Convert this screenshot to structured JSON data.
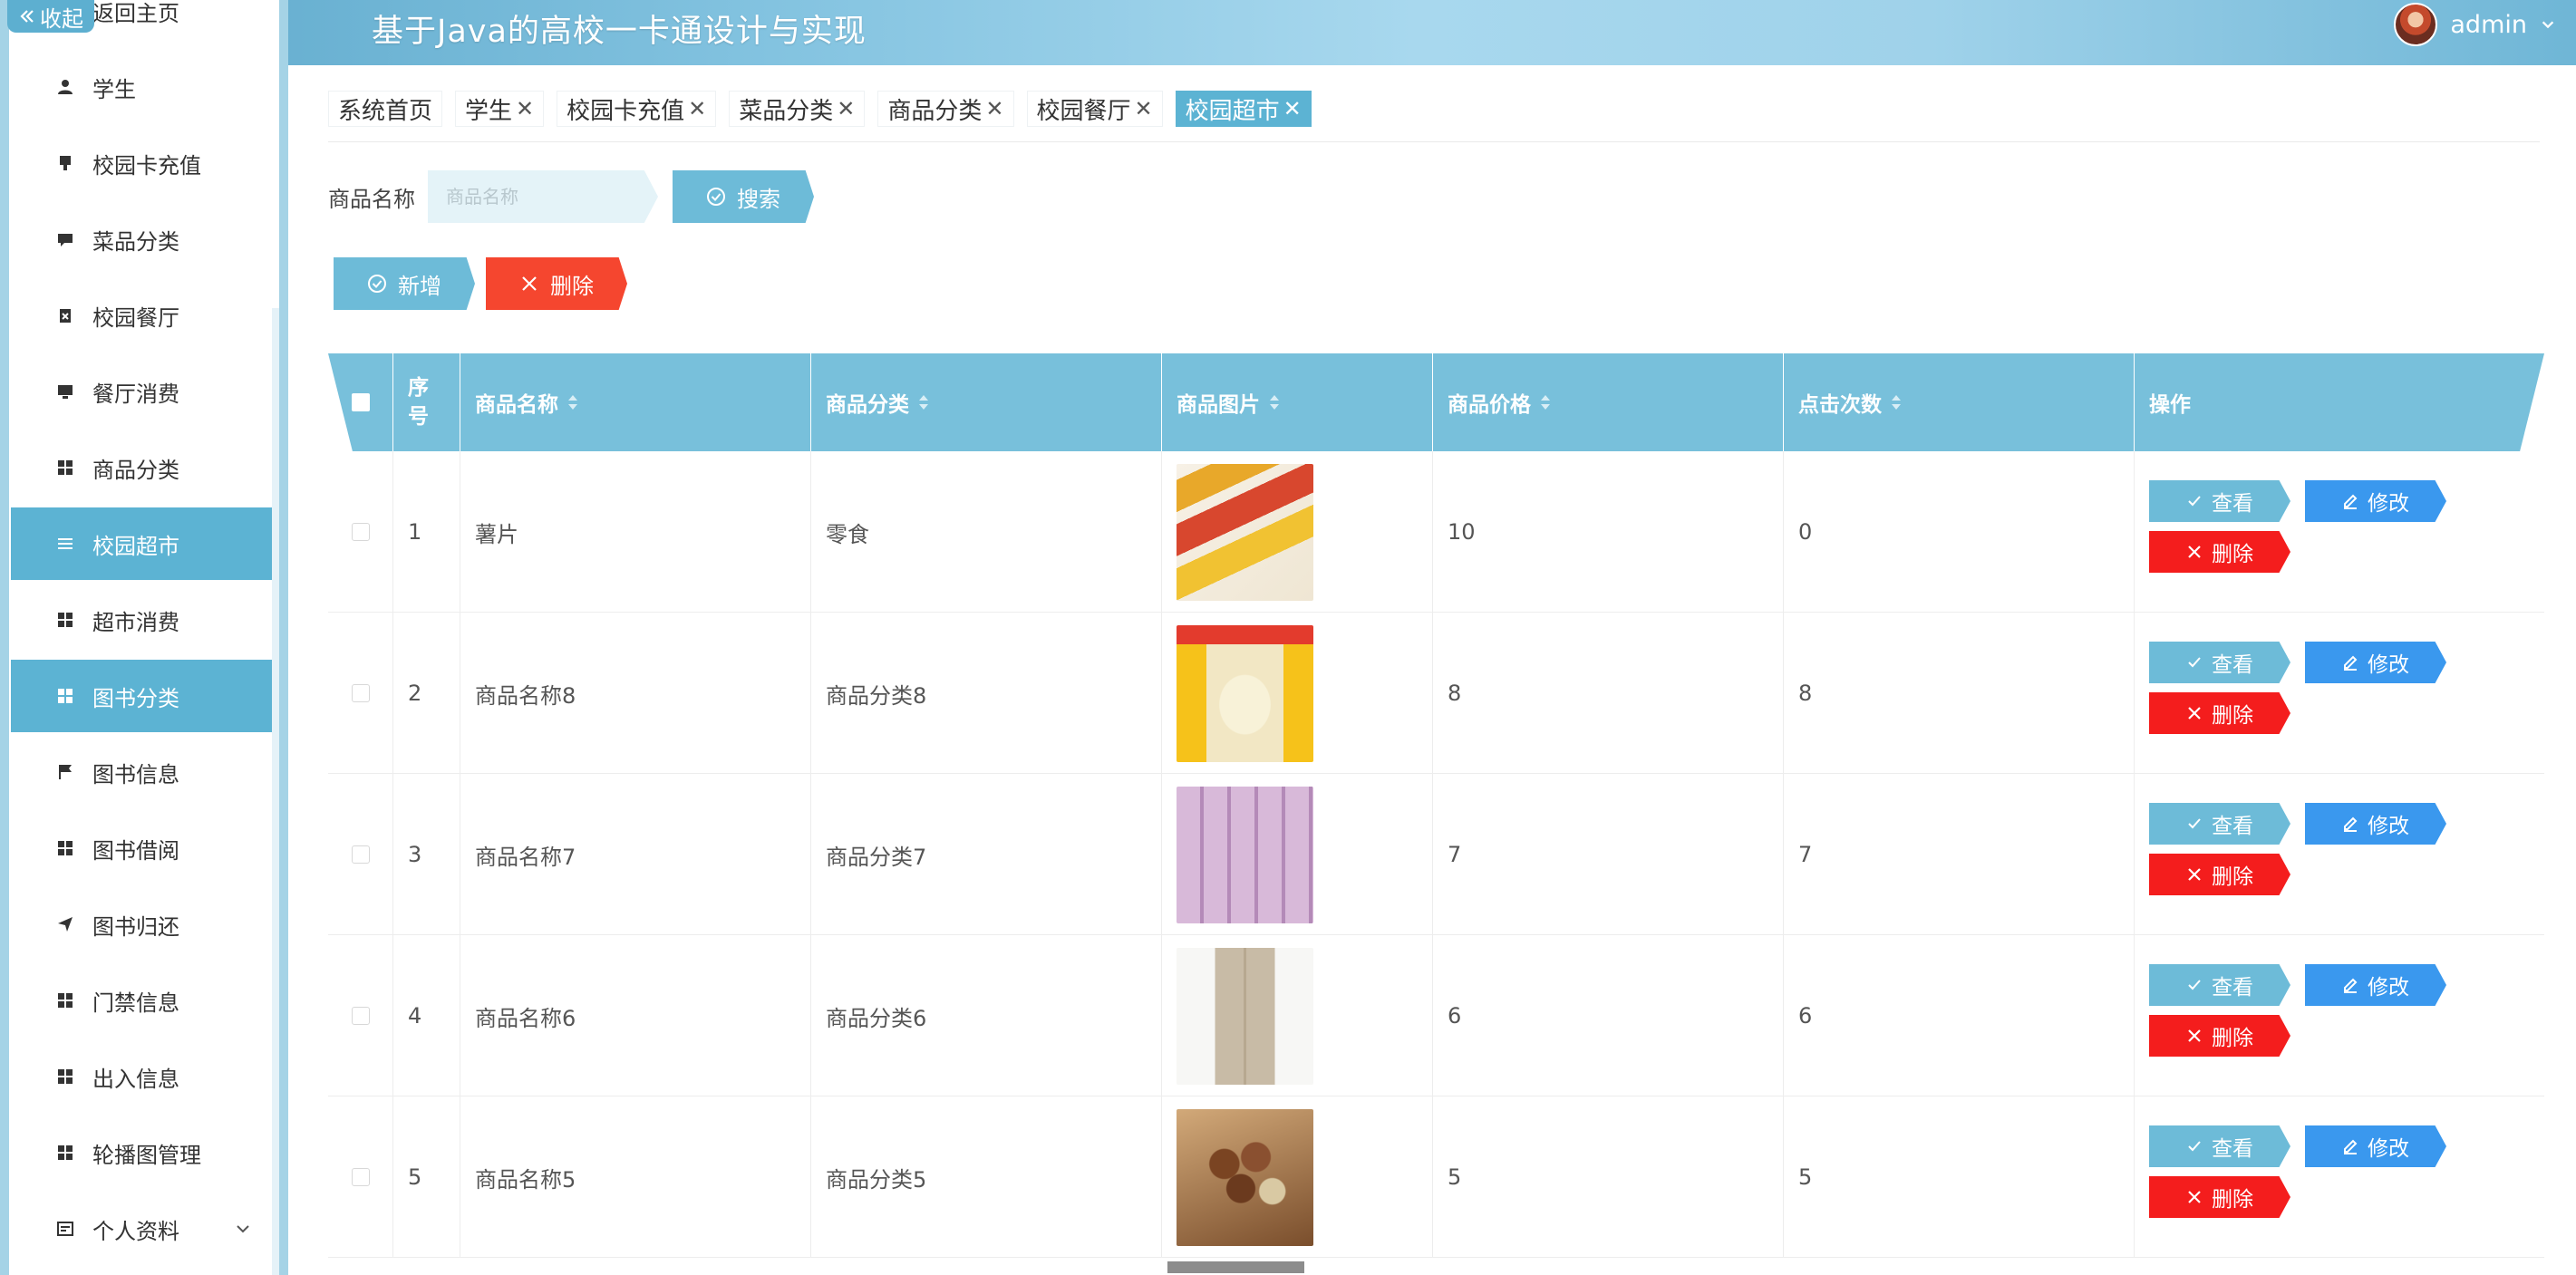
{
  "header": {
    "title": "基于Java的高校一卡通设计与实现",
    "user_name": "admin"
  },
  "sidebar": {
    "collapse_label": "收起",
    "items": [
      {
        "label": "返回主页",
        "icon": "home-icon"
      },
      {
        "label": "学生",
        "icon": "user-icon"
      },
      {
        "label": "校园卡充值",
        "icon": "card-icon"
      },
      {
        "label": "菜品分类",
        "icon": "comment-icon"
      },
      {
        "label": "校园餐厅",
        "icon": "clipboard-icon"
      },
      {
        "label": "餐厅消费",
        "icon": "monitor-icon"
      },
      {
        "label": "商品分类",
        "icon": "grid-icon"
      },
      {
        "label": "校园超市",
        "icon": "list-icon",
        "active": true
      },
      {
        "label": "超市消费",
        "icon": "grid-icon"
      },
      {
        "label": "图书分类",
        "icon": "grid-icon",
        "hover": true
      },
      {
        "label": "图书信息",
        "icon": "flag-icon"
      },
      {
        "label": "图书借阅",
        "icon": "grid-icon"
      },
      {
        "label": "图书归还",
        "icon": "send-icon"
      },
      {
        "label": "门禁信息",
        "icon": "grid-icon"
      },
      {
        "label": "出入信息",
        "icon": "grid-icon"
      },
      {
        "label": "轮播图管理",
        "icon": "grid-icon"
      },
      {
        "label": "个人资料",
        "icon": "profile-icon"
      }
    ]
  },
  "tabs": [
    {
      "label": "系统首页",
      "closable": false
    },
    {
      "label": "学生",
      "closable": true
    },
    {
      "label": "校园卡充值",
      "closable": true
    },
    {
      "label": "菜品分类",
      "closable": true
    },
    {
      "label": "商品分类",
      "closable": true
    },
    {
      "label": "校园餐厅",
      "closable": true
    },
    {
      "label": "校园超市",
      "closable": true,
      "active": true
    }
  ],
  "tab_close_glyph": "✕",
  "search": {
    "label": "商品名称",
    "placeholder": "商品名称",
    "value": "",
    "button_label": "搜索"
  },
  "actions": {
    "add_label": "新增",
    "delete_label": "删除"
  },
  "table": {
    "columns": {
      "index": [
        "序",
        "号"
      ],
      "name": "商品名称",
      "category": "商品分类",
      "image": "商品图片",
      "price": "商品价格",
      "clicks": "点击次数",
      "ops": "操作"
    },
    "row_actions": {
      "view": "查看",
      "edit": "修改",
      "delete": "删除"
    },
    "rows": [
      {
        "index": "1",
        "name": "薯片",
        "category": "零食",
        "image": "potato-chips-photo",
        "price": "10",
        "clicks": "0"
      },
      {
        "index": "2",
        "name": "商品名称8",
        "category": "商品分类8",
        "image": "snack-box-photo",
        "price": "8",
        "clicks": "8"
      },
      {
        "index": "3",
        "name": "商品名称7",
        "category": "商品分类7",
        "image": "shelf-boxes-photo",
        "price": "7",
        "clicks": "7"
      },
      {
        "index": "4",
        "name": "商品名称6",
        "category": "商品分类6",
        "image": "refrigerator-photo",
        "price": "6",
        "clicks": "6"
      },
      {
        "index": "5",
        "name": "商品名称5",
        "category": "商品分类5",
        "image": "macadamia-nuts-photo",
        "price": "5",
        "clicks": "5"
      }
    ]
  },
  "colors": {
    "primary": "#5cb3d3",
    "table_header": "#78c0db",
    "danger": "#f41d1d",
    "edit_blue": "#3a98ee"
  }
}
